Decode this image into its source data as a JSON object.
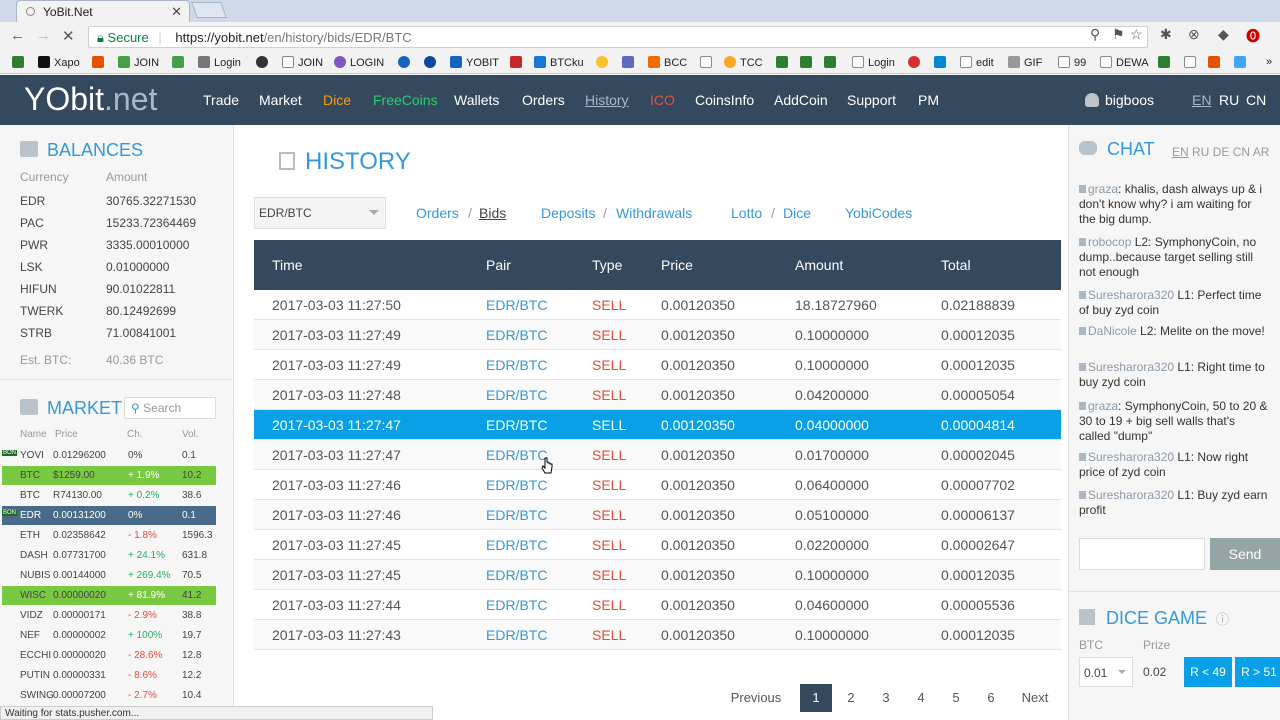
{
  "browser": {
    "tab_title": "YoBit.Net",
    "secure_label": "Secure",
    "url_base": "https://yobit.net",
    "url_path": "/en/history/bids/EDR/BTC",
    "bookmarks": [
      "Xapo",
      "JOIN",
      "Login",
      "JOIN",
      "LOGIN",
      "YOBIT",
      "BTCku",
      "BCC",
      "TCC",
      "Login",
      "edit",
      "GIF",
      "99",
      "DEWA"
    ],
    "status_text": "Waiting for stats.pusher.com..."
  },
  "nav": {
    "logo_a": "YObit",
    "logo_b": ".net",
    "links": [
      "Trade",
      "Market",
      "Dice",
      "FreeCoins",
      "Wallets",
      "Orders",
      "History",
      "ICO",
      "CoinsInfo",
      "AddCoin",
      "Support",
      "PM"
    ],
    "user": "bigboos",
    "langs": [
      "EN",
      "RU",
      "CN"
    ]
  },
  "balances": {
    "title": "BALANCES",
    "col_currency": "Currency",
    "col_amount": "Amount",
    "rows": [
      {
        "c": "EDR",
        "a": "30765.32271530"
      },
      {
        "c": "PAC",
        "a": "15233.72364469"
      },
      {
        "c": "PWR",
        "a": "3335.00010000"
      },
      {
        "c": "LSK",
        "a": "0.01000000"
      },
      {
        "c": "HIFUN",
        "a": "90.01022811"
      },
      {
        "c": "TWERK",
        "a": "80.12492699"
      },
      {
        "c": "STRB",
        "a": "71.00841001"
      }
    ],
    "est_label": "Est. BTC:",
    "est_value": "40.36 BTC"
  },
  "market": {
    "title": "MARKET",
    "search_placeholder": "Search",
    "headers": [
      "Name",
      "Price",
      "Ch.",
      "Vol."
    ],
    "rows": [
      {
        "n": "YOVI",
        "p": "0.01296200",
        "ch": "0%",
        "v": "0.1",
        "badge": "BON",
        "style": ""
      },
      {
        "n": "BTC",
        "p": "$1259.00",
        "ch": "+ 1.9%",
        "v": "10.2",
        "badge": "",
        "style": "g"
      },
      {
        "n": "BTC",
        "p": "R74130.00",
        "ch": "+ 0.2%",
        "v": "38.6",
        "badge": "",
        "style": ""
      },
      {
        "n": "EDR",
        "p": "0.00131200",
        "ch": "0%",
        "v": "0.1",
        "badge": "BON",
        "style": "sel"
      },
      {
        "n": "ETH",
        "p": "0.02358642",
        "ch": "- 1.8%",
        "v": "1596.3",
        "badge": "",
        "style": ""
      },
      {
        "n": "DASH",
        "p": "0.07731700",
        "ch": "+ 24.1%",
        "v": "631.8",
        "badge": "",
        "style": ""
      },
      {
        "n": "NUBIS",
        "p": "0.00144000",
        "ch": "+ 269.4%",
        "v": "70.5",
        "badge": "",
        "style": ""
      },
      {
        "n": "WISC",
        "p": "0.00000020",
        "ch": "+ 81.9%",
        "v": "41.2",
        "badge": "",
        "style": "g"
      },
      {
        "n": "VIDZ",
        "p": "0.00000171",
        "ch": "- 2.9%",
        "v": "38.8",
        "badge": "",
        "style": ""
      },
      {
        "n": "NEF",
        "p": "0.00000002",
        "ch": "+ 100%",
        "v": "19.7",
        "badge": "",
        "style": ""
      },
      {
        "n": "ECCHI",
        "p": "0.00000020",
        "ch": "- 28.6%",
        "v": "12.8",
        "badge": "",
        "style": ""
      },
      {
        "n": "PUTIN",
        "p": "0.00000331",
        "ch": "- 8.6%",
        "v": "12.2",
        "badge": "",
        "style": ""
      },
      {
        "n": "SWING",
        "p": "0.00007200",
        "ch": "- 2.7%",
        "v": "10.4",
        "badge": "",
        "style": ""
      }
    ]
  },
  "history": {
    "title": "HISTORY",
    "pair_select": "EDR/BTC",
    "filters": [
      "Orders",
      "/",
      "Bids",
      "Deposits",
      "/",
      "Withdrawals",
      "Lotto",
      "/",
      "Dice",
      "YobiCodes"
    ],
    "headers": [
      "Time",
      "Pair",
      "Type",
      "Price",
      "Amount",
      "Total"
    ],
    "rows": [
      {
        "time": "2017-03-03 11:27:50",
        "pair": "EDR/BTC",
        "type": "SELL",
        "price": "0.00120350",
        "amount": "18.18727960",
        "total": "0.02188839"
      },
      {
        "time": "2017-03-03 11:27:49",
        "pair": "EDR/BTC",
        "type": "SELL",
        "price": "0.00120350",
        "amount": "0.10000000",
        "total": "0.00012035"
      },
      {
        "time": "2017-03-03 11:27:49",
        "pair": "EDR/BTC",
        "type": "SELL",
        "price": "0.00120350",
        "amount": "0.10000000",
        "total": "0.00012035"
      },
      {
        "time": "2017-03-03 11:27:48",
        "pair": "EDR/BTC",
        "type": "SELL",
        "price": "0.00120350",
        "amount": "0.04200000",
        "total": "0.00005054"
      },
      {
        "time": "2017-03-03 11:27:47",
        "pair": "EDR/BTC",
        "type": "SELL",
        "price": "0.00120350",
        "amount": "0.04000000",
        "total": "0.00004814"
      },
      {
        "time": "2017-03-03 11:27:47",
        "pair": "EDR/BTC",
        "type": "SELL",
        "price": "0.00120350",
        "amount": "0.01700000",
        "total": "0.00002045"
      },
      {
        "time": "2017-03-03 11:27:46",
        "pair": "EDR/BTC",
        "type": "SELL",
        "price": "0.00120350",
        "amount": "0.06400000",
        "total": "0.00007702"
      },
      {
        "time": "2017-03-03 11:27:46",
        "pair": "EDR/BTC",
        "type": "SELL",
        "price": "0.00120350",
        "amount": "0.05100000",
        "total": "0.00006137"
      },
      {
        "time": "2017-03-03 11:27:45",
        "pair": "EDR/BTC",
        "type": "SELL",
        "price": "0.00120350",
        "amount": "0.02200000",
        "total": "0.00002647"
      },
      {
        "time": "2017-03-03 11:27:45",
        "pair": "EDR/BTC",
        "type": "SELL",
        "price": "0.00120350",
        "amount": "0.10000000",
        "total": "0.00012035"
      },
      {
        "time": "2017-03-03 11:27:44",
        "pair": "EDR/BTC",
        "type": "SELL",
        "price": "0.00120350",
        "amount": "0.04600000",
        "total": "0.00005536"
      },
      {
        "time": "2017-03-03 11:27:43",
        "pair": "EDR/BTC",
        "type": "SELL",
        "price": "0.00120350",
        "amount": "0.10000000",
        "total": "0.00012035"
      }
    ],
    "highlighted_row": 4,
    "pagination": [
      "Previous",
      "1",
      "2",
      "3",
      "4",
      "5",
      "6",
      "Next"
    ],
    "active_page": "1"
  },
  "chat": {
    "title": "CHAT",
    "langs": [
      "EN",
      "RU",
      "DE",
      "CN",
      "AR"
    ],
    "messages": [
      {
        "user": "graza",
        "text": ": khalis, dash always up & i don't know why? i am waiting for the big dump."
      },
      {
        "user": "robocop",
        "text": " L2: SymphonyCoin, no dump..because target selling still not enough"
      },
      {
        "user": "Suresharora320",
        "text": " L1: Perfect time of buy zyd coin"
      },
      {
        "user": "DaNicole",
        "text": " L2: Melite on the move!"
      },
      {
        "user": "Suresharora320",
        "text": " L1: Right time to buy zyd coin"
      },
      {
        "user": "graza",
        "text": ": SymphonyCoin, 50 to 20 & 30 to 19 + big sell walls that's called \"dump\""
      },
      {
        "user": "Suresharora320",
        "text": " L1: Now right price of zyd coin"
      },
      {
        "user": "Suresharora320",
        "text": " L1: Buy zyd earn profit"
      }
    ],
    "send_label": "Send"
  },
  "dice": {
    "title": "DICE GAME",
    "btc_label": "BTC",
    "prize_label": "Prize",
    "bet_value": "0.01",
    "prize_value": "0.02",
    "low_button": "R < 49",
    "high_button": "R > 51"
  },
  "colors": {
    "nav_bg": "#34495e",
    "accent": "#3498db",
    "highlight": "#0aa0e8",
    "sell": "#e74c3c",
    "green": "#7ac943"
  }
}
